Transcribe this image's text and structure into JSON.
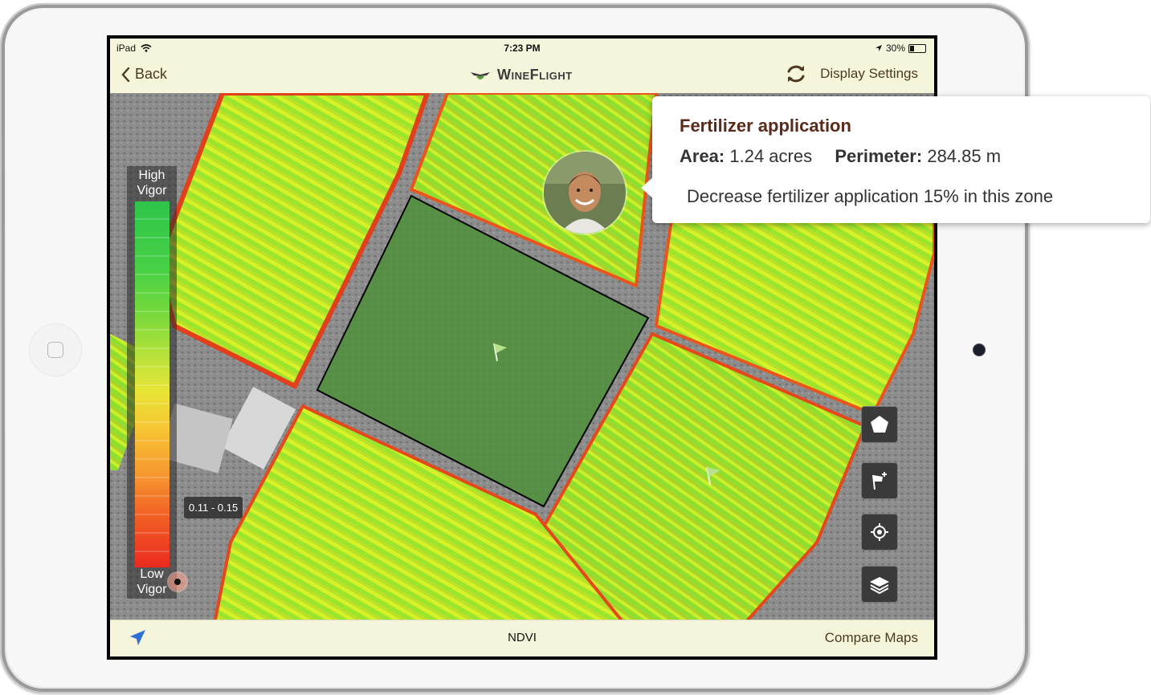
{
  "status_bar": {
    "device": "iPad",
    "time": "7:23 PM",
    "battery": "30%",
    "battery_level": 0.3
  },
  "nav": {
    "back_label": "Back",
    "app_name": "WineFlight",
    "settings_label": "Display Settings"
  },
  "legend": {
    "top_label_1": "High",
    "top_label_2": "Vigor",
    "bottom_label_1": "Low",
    "bottom_label_2": "Vigor",
    "selected_range": "0.11 - 0.15"
  },
  "callout": {
    "title": "Fertilizer application",
    "area_label": "Area:",
    "area_value": "1.24 acres",
    "perimeter_label": "Perimeter:",
    "perimeter_value": "284.85 m",
    "note": "Decrease fertilizer application 15% in this zone"
  },
  "tools": {
    "polygon": "pentagon-icon",
    "add_flag": "add-flag-icon",
    "locate": "crosshair-icon",
    "layers": "layers-icon"
  },
  "bottom_bar": {
    "layer_name": "NDVI",
    "compare_label": "Compare Maps"
  },
  "colors": {
    "bar_background": "#f5f5dc",
    "accent_brown": "#4a3a20",
    "zone_fill": "#4e8f3a",
    "nav_arrow_blue": "#2f6fd6"
  }
}
